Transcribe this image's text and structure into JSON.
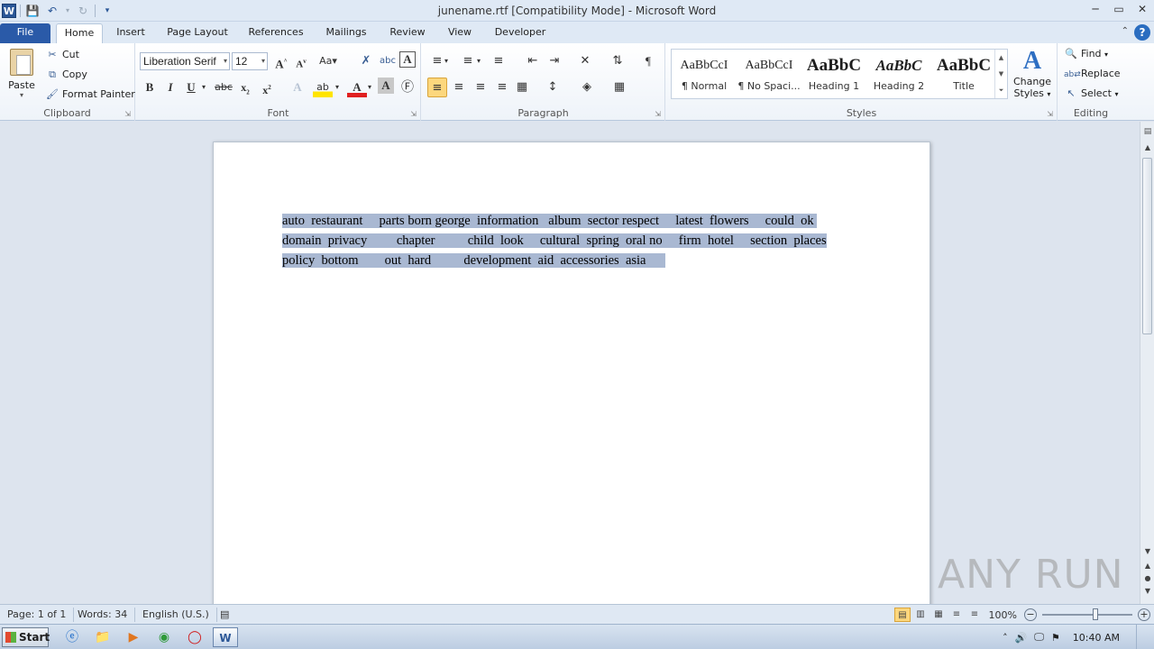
{
  "window": {
    "title": "junename.rtf [Compatibility Mode]  -  Microsoft Word",
    "controls": [
      "─",
      "▭",
      "✕"
    ]
  },
  "qat": {
    "app_icon": "W"
  },
  "tabs": [
    {
      "label": "File"
    },
    {
      "label": "Home"
    },
    {
      "label": "Insert"
    },
    {
      "label": "Page Layout"
    },
    {
      "label": "References"
    },
    {
      "label": "Mailings"
    },
    {
      "label": "Review"
    },
    {
      "label": "View"
    },
    {
      "label": "Developer"
    }
  ],
  "ribbon": {
    "clipboard": {
      "label": "Clipboard",
      "paste": "Paste",
      "cut": "Cut",
      "copy": "Copy",
      "format_painter": "Format Painter"
    },
    "font": {
      "label": "Font",
      "font_name": "Liberation Serif",
      "font_size": "12"
    },
    "paragraph": {
      "label": "Paragraph"
    },
    "styles": {
      "label": "Styles",
      "items": [
        {
          "preview": "AaBbCcI",
          "name": "¶ Normal"
        },
        {
          "preview": "AaBbCcI",
          "name": "¶ No Spaci..."
        },
        {
          "preview": "AaBbC",
          "name": "Heading 1"
        },
        {
          "preview": "AaBbC",
          "name": "Heading 2"
        },
        {
          "preview": "AaBbC",
          "name": "Title"
        }
      ],
      "change_styles_line1": "Change",
      "change_styles_line2": "Styles"
    },
    "editing": {
      "label": "Editing",
      "find": "Find",
      "replace": "Replace",
      "select": "Select"
    }
  },
  "document": {
    "lines": [
      "auto  restaurant     parts born george  information   album  sector respect     latest  flowers     could  ok ",
      "domain  privacy         chapter          child  look     cultural  spring  oral no     firm  hotel     section  places",
      "policy  bottom        out  hard          development  aid  accessories  asia      "
    ]
  },
  "statusbar": {
    "page": "Page: 1 of 1",
    "words": "Words: 34",
    "language": "English (U.S.)",
    "zoom": "100%"
  },
  "taskbar": {
    "start": "Start",
    "time": "10:40 AM"
  },
  "watermark": "ANY RUN"
}
